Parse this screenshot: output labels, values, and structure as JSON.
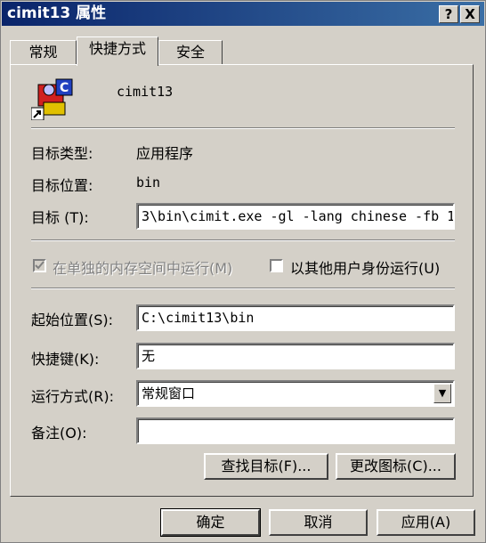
{
  "window": {
    "title": "cimit13 属性",
    "help_btn": "?",
    "close_btn": "X"
  },
  "tabs": [
    {
      "label": "常规"
    },
    {
      "label": "快捷方式"
    },
    {
      "label": "安全"
    }
  ],
  "shortcut": {
    "name": "cimit13",
    "target_type_label": "目标类型:",
    "target_type_value": "应用程序",
    "target_location_label": "目标位置:",
    "target_location_value": "bin",
    "target_label": "目标 (T):",
    "target_value": "3\\bin\\cimit.exe -gl -lang chinese -fb 1",
    "run_separate_label": "在单独的内存空间中运行(M)",
    "run_separate_checked": true,
    "run_other_user_label": "以其他用户身份运行(U)",
    "run_other_user_checked": false,
    "start_in_label": "起始位置(S):",
    "start_in_value": "C:\\cimit13\\bin",
    "hotkey_label": "快捷键(K):",
    "hotkey_value": "无",
    "run_label": "运行方式(R):",
    "run_value": "常规窗口",
    "comment_label": "备注(O):",
    "comment_value": "",
    "find_target_btn": "查找目标(F)...",
    "change_icon_btn": "更改图标(C)..."
  },
  "footer": {
    "ok": "确定",
    "cancel": "取消",
    "apply": "应用(A)"
  }
}
